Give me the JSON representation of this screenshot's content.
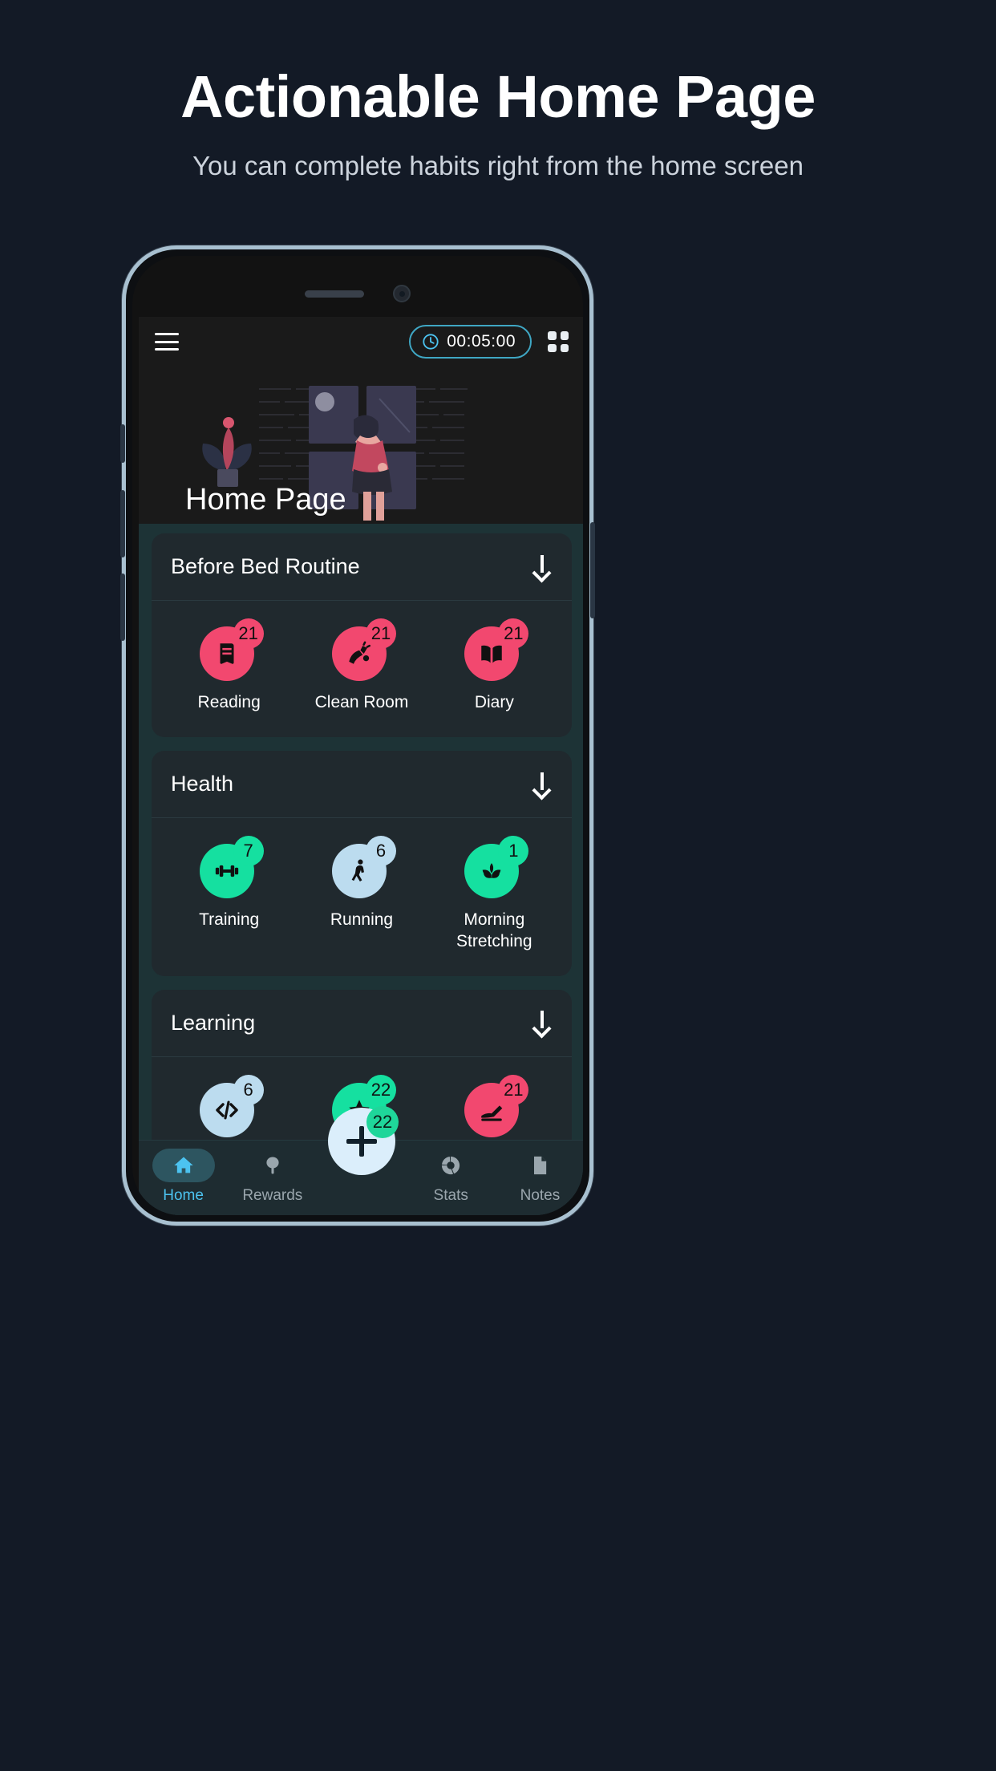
{
  "promo": {
    "title": "Actionable Home Page",
    "subtitle": "You can complete habits right from the home screen"
  },
  "app": {
    "header": {
      "menu_icon": "hamburger-menu-icon",
      "timer_icon": "clock-icon",
      "timer_value": "00:05:00",
      "grid_icon": "grid-view-icon"
    },
    "hero": {
      "title": "Home Page"
    },
    "sections": [
      {
        "title": "Before Bed Routine",
        "collapse_icon": "arrow-down-icon",
        "habits": [
          {
            "label": "Reading",
            "count": "21",
            "color": "#f2486f",
            "icon": "book-icon"
          },
          {
            "label": "Clean Room",
            "count": "21",
            "color": "#f2486f",
            "icon": "broom-icon"
          },
          {
            "label": "Diary",
            "count": "21",
            "color": "#f2486f",
            "icon": "open-book-icon"
          }
        ]
      },
      {
        "title": "Health",
        "collapse_icon": "arrow-down-icon",
        "habits": [
          {
            "label": "Training",
            "count": "7",
            "color": "#15e0a0",
            "icon": "dumbbell-icon"
          },
          {
            "label": "Running",
            "count": "6",
            "color": "#bcdcef",
            "icon": "walking-person-icon"
          },
          {
            "label": "Morning Stretching",
            "count": "1",
            "color": "#15e0a0",
            "icon": "lotus-icon"
          }
        ]
      },
      {
        "title": "Learning",
        "collapse_icon": "arrow-down-icon",
        "habits": [
          {
            "label": "",
            "count": "6",
            "color": "#bcdcef",
            "icon": "code-icon"
          },
          {
            "label": "",
            "count": "22",
            "color": "#15e0a0",
            "icon": "star-icon"
          },
          {
            "label": "",
            "count": "21",
            "color": "#f2486f",
            "icon": "writing-hand-icon"
          }
        ]
      }
    ],
    "fab": {
      "icon": "plus-icon",
      "badge": "22"
    },
    "bottom_nav": [
      {
        "label": "Home",
        "icon": "home-icon",
        "active": true
      },
      {
        "label": "Rewards",
        "icon": "tree-icon",
        "active": false
      },
      {
        "label": "Stats",
        "icon": "donut-chart-icon",
        "active": false
      },
      {
        "label": "Notes",
        "icon": "document-icon",
        "active": false
      }
    ]
  },
  "colors": {
    "page_bg": "#131a26",
    "accent_cyan": "#4cc3f0",
    "accent_pink": "#f2486f",
    "accent_green": "#15e0a0",
    "accent_blue": "#bcdcef",
    "card_bg": "#20292e",
    "body_bg": "#1d3336"
  }
}
